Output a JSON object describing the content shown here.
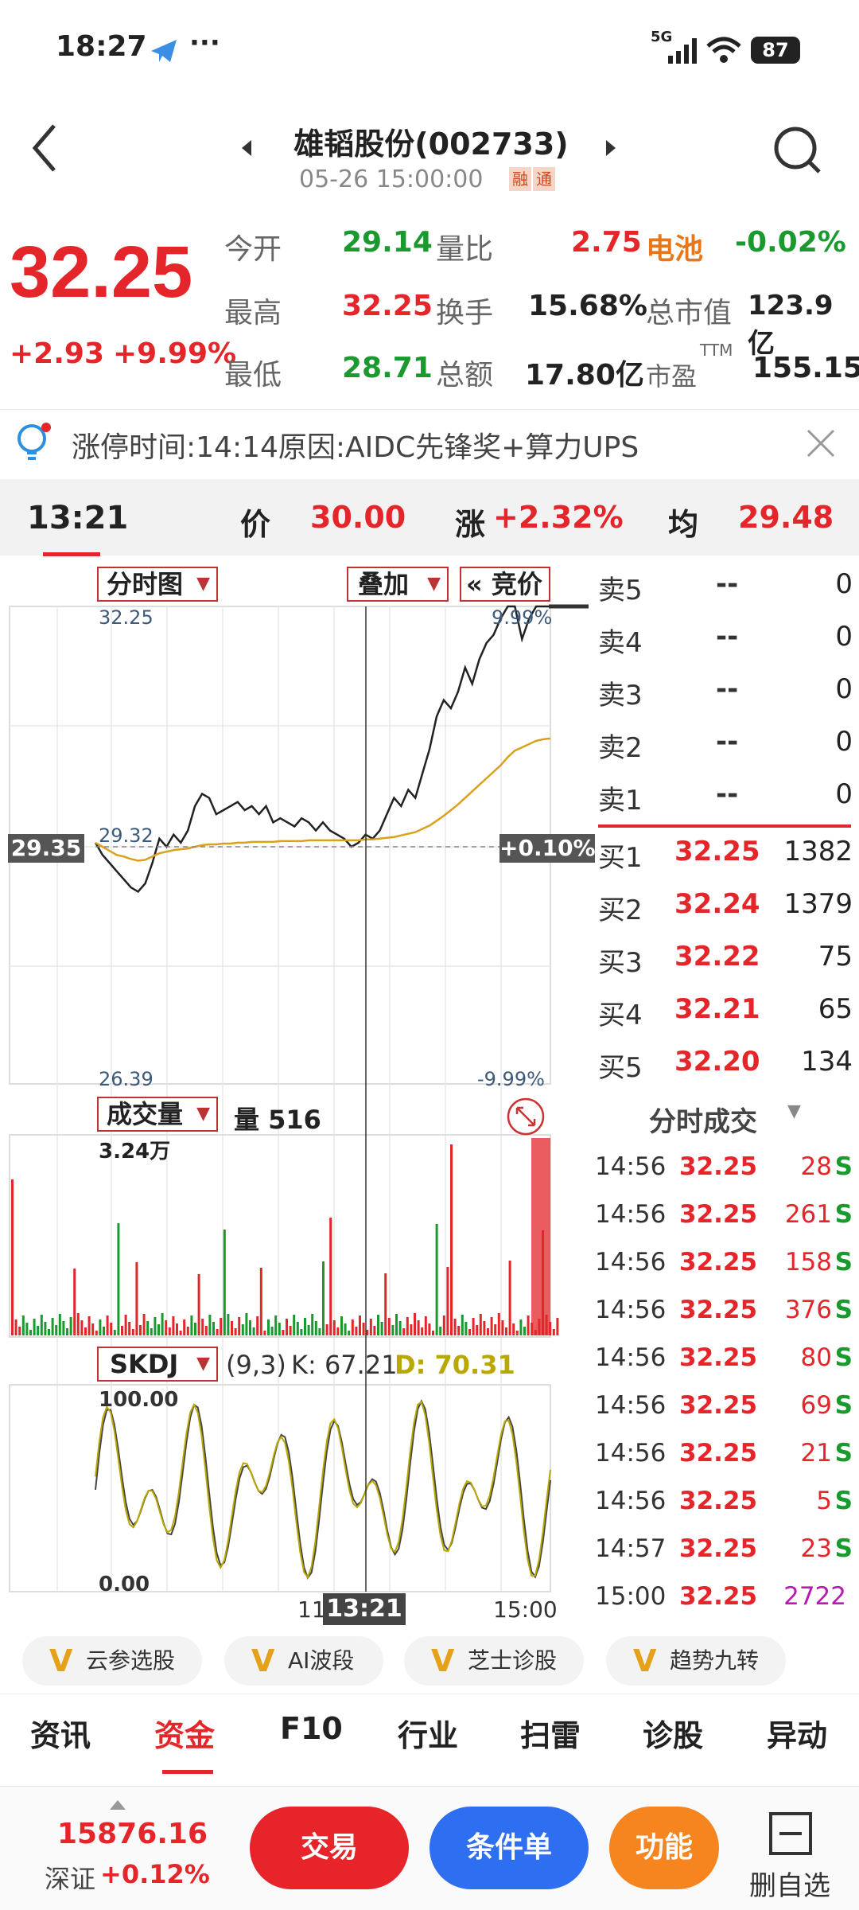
{
  "status_bar": {
    "time": "18:27",
    "more": "···",
    "network": "5G",
    "battery": "87"
  },
  "header": {
    "stock_name": "雄韬股份(002733)",
    "datetime": "05-26 15:00:00",
    "badge_rong": "融",
    "badge_tong": "通"
  },
  "quote": {
    "price": "32.25",
    "change": "+2.93",
    "change_pct": "+9.99%",
    "open_label": "今开",
    "open": "29.14",
    "high_label": "最高",
    "high": "32.25",
    "low_label": "最低",
    "low": "28.71",
    "vol_ratio_label": "量比",
    "vol_ratio": "2.75",
    "turnover_label": "换手",
    "turnover": "15.68%",
    "amount_label": "总额",
    "amount": "17.80亿",
    "sector": "电池",
    "sector_change": "-0.02%",
    "mktcap_label": "总市值",
    "mktcap": "123.9亿",
    "pe_label": "市盈",
    "pe_sup": "TTM",
    "pe": "155.15"
  },
  "notice": {
    "text": "涨停时间:14:14原因:AIDC先锋奖+算力UPS"
  },
  "cursor": {
    "time": "13:21",
    "price_label": "价",
    "price": "30.00",
    "chg_label": "涨",
    "chg": "+2.32%",
    "avg_label": "均",
    "avg": "29.48"
  },
  "chart": {
    "mode": "分时图",
    "overlay": "叠加",
    "auction": "« 竞价",
    "y_top": "32.25",
    "y_mid": "29.32",
    "y_bottom": "26.39",
    "pct_top": "9.99%",
    "pct_bottom": "-9.99%",
    "left_tag": "29.35",
    "right_tag": "+0.10%",
    "volume_label": "成交量",
    "volume_text": "量 516",
    "volume_max": "3.24万",
    "kdj_label": "SKDJ",
    "kdj_params": "(9,3)",
    "kdj_k": "K: 67.21",
    "kdj_d": "D: 70.31",
    "kdj_top": "100.00",
    "kdj_bottom": "0.00",
    "x_mid": "11:",
    "x_cursor": "13:21",
    "x_end": "15:00"
  },
  "chart_data": {
    "type": "line",
    "x_range": [
      "09:30",
      "15:00"
    ],
    "ylim": [
      26.39,
      32.25
    ],
    "prev_close": 29.32,
    "cursor_time": "13:21",
    "series": [
      {
        "values": [
          29.35,
          29.2,
          29.1,
          29.0,
          28.9,
          28.8,
          28.75,
          28.85,
          29.1,
          29.4,
          29.3,
          29.45,
          29.35,
          29.5,
          29.8,
          29.95,
          29.9,
          29.7,
          29.75,
          29.8,
          29.85,
          29.75,
          29.8,
          29.7,
          29.8,
          29.6,
          29.65,
          29.6,
          29.55,
          29.65,
          29.6,
          29.5,
          29.6,
          29.5,
          29.45,
          29.4,
          29.3,
          29.35,
          29.45,
          29.4,
          29.5,
          29.7,
          29.9,
          29.8,
          30.0,
          29.9,
          30.2,
          30.5,
          30.9,
          31.1,
          31.0,
          31.2,
          31.5,
          31.3,
          31.6,
          31.8,
          31.9,
          32.1,
          32.25,
          32.25,
          31.85,
          32.1,
          32.25,
          32.25,
          32.25
        ]
      },
      {
        "values": [
          29.35,
          29.3,
          29.25,
          29.2,
          29.18,
          29.15,
          29.13,
          29.14,
          29.18,
          29.22,
          29.24,
          29.26,
          29.27,
          29.28,
          29.3,
          29.32,
          29.33,
          29.33,
          29.34,
          29.34,
          29.35,
          29.35,
          29.36,
          29.36,
          29.36,
          29.36,
          29.37,
          29.37,
          29.37,
          29.37,
          29.38,
          29.38,
          29.38,
          29.38,
          29.38,
          29.38,
          29.38,
          29.38,
          29.39,
          29.39,
          29.4,
          29.41,
          29.42,
          29.44,
          29.46,
          29.48,
          29.52,
          29.56,
          29.62,
          29.68,
          29.75,
          29.82,
          29.9,
          29.98,
          30.06,
          30.14,
          30.22,
          30.3,
          30.4,
          30.48,
          30.52,
          30.56,
          30.6,
          30.62,
          30.63
        ]
      }
    ]
  },
  "order_book": {
    "sell": [
      {
        "label": "卖5",
        "price": "--",
        "vol": "0"
      },
      {
        "label": "卖4",
        "price": "--",
        "vol": "0"
      },
      {
        "label": "卖3",
        "price": "--",
        "vol": "0"
      },
      {
        "label": "卖2",
        "price": "--",
        "vol": "0"
      },
      {
        "label": "卖1",
        "price": "--",
        "vol": "0"
      }
    ],
    "buy": [
      {
        "label": "买1",
        "price": "32.25",
        "vol": "1382"
      },
      {
        "label": "买2",
        "price": "32.24",
        "vol": "1379"
      },
      {
        "label": "买3",
        "price": "32.22",
        "vol": "75"
      },
      {
        "label": "买4",
        "price": "32.21",
        "vol": "65"
      },
      {
        "label": "买5",
        "price": "32.20",
        "vol": "134"
      }
    ]
  },
  "trades": {
    "title": "分时成交",
    "rows": [
      {
        "time": "14:56",
        "price": "32.25",
        "vol": "28",
        "side": "S"
      },
      {
        "time": "14:56",
        "price": "32.25",
        "vol": "261",
        "side": "S"
      },
      {
        "time": "14:56",
        "price": "32.25",
        "vol": "158",
        "side": "S"
      },
      {
        "time": "14:56",
        "price": "32.25",
        "vol": "376",
        "side": "S"
      },
      {
        "time": "14:56",
        "price": "32.25",
        "vol": "80",
        "side": "S"
      },
      {
        "time": "14:56",
        "price": "32.25",
        "vol": "69",
        "side": "S"
      },
      {
        "time": "14:56",
        "price": "32.25",
        "vol": "21",
        "side": "S"
      },
      {
        "time": "14:56",
        "price": "32.25",
        "vol": "5",
        "side": "S"
      },
      {
        "time": "14:57",
        "price": "32.25",
        "vol": "23",
        "side": "S"
      },
      {
        "time": "15:00",
        "price": "32.25",
        "vol": "2722",
        "side": ""
      }
    ]
  },
  "pills": [
    "云参选股",
    "AI波段",
    "芝士诊股",
    "趋势九转"
  ],
  "tabs": [
    "资讯",
    "资金",
    "F10",
    "行业",
    "扫雷",
    "诊股",
    "异动"
  ],
  "bottom": {
    "index_value": "15876.16",
    "index_name": "深证",
    "index_change": "+0.12%",
    "btn_trade": "交易",
    "btn_condition": "条件单",
    "btn_function": "功能",
    "btn_remove": "删自选"
  },
  "colors": {
    "up": "#e4262b",
    "down": "#1a9a2e",
    "avg_line": "#d9a21a",
    "btn_trade": "#e8242b",
    "btn_condition": "#2d6ff0",
    "btn_function": "#f6841f"
  }
}
